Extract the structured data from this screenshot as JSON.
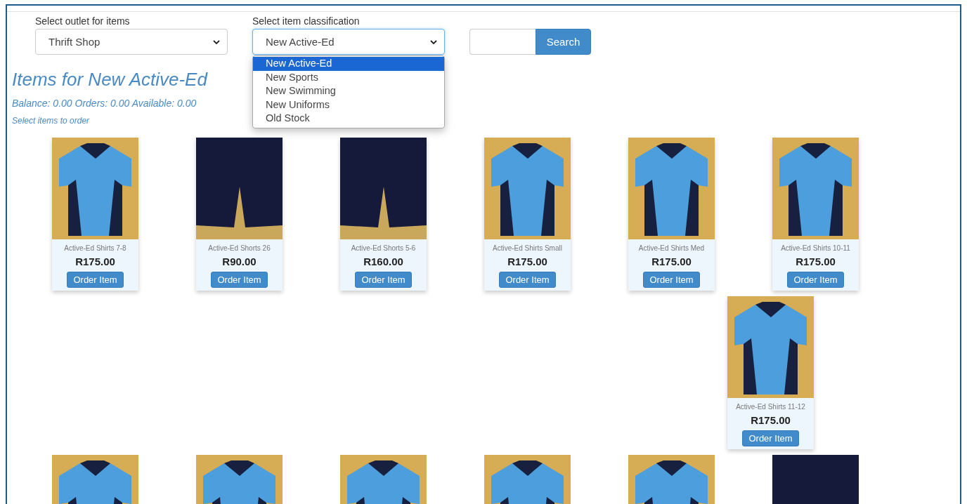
{
  "outlet_select": {
    "label": "Select outlet for items",
    "value": "Thrift Shop"
  },
  "classification_select": {
    "label": "Select item classification",
    "value": "New Active-Ed",
    "expanded": true,
    "options": [
      {
        "label": "New Active-Ed",
        "selected": true
      },
      {
        "label": "New Sports",
        "selected": false
      },
      {
        "label": "New Swimming",
        "selected": false
      },
      {
        "label": "New Uniforms",
        "selected": false
      },
      {
        "label": "Old Stock",
        "selected": false
      }
    ]
  },
  "search": {
    "button": "Search"
  },
  "heading": "Items for New Active-Ed",
  "balance_line": "Balance: 0.00 Orders: 0.00 Available: 0.00",
  "instruction": "Select items to order",
  "rows": [
    {
      "kind": "full",
      "items": [
        {
          "kind": "shirt",
          "name": "Active-Ed Shirts 7-8",
          "price": "R175.00",
          "button": "Order Item"
        },
        {
          "kind": "shorts",
          "name": "Active-Ed Shorts 26",
          "price": "R90.00",
          "button": "Order Item"
        },
        {
          "kind": "shorts",
          "name": "Active-Ed Shorts 5-6",
          "price": "R160.00",
          "button": "Order Item"
        },
        {
          "kind": "shirt",
          "name": "Active-Ed Shirts Small",
          "price": "R175.00",
          "button": "Order Item"
        },
        {
          "kind": "shirt",
          "name": "Active-Ed Shirts Med",
          "price": "R175.00",
          "button": "Order Item"
        },
        {
          "kind": "shirt",
          "name": "Active-Ed Shirts 10-11",
          "price": "R175.00",
          "button": "Order Item"
        }
      ]
    },
    {
      "kind": "last-column",
      "items": [
        {
          "kind": "shirt",
          "name": "Active-Ed Shirts 11-12",
          "price": "R175.00",
          "button": "Order Item"
        }
      ]
    },
    {
      "kind": "full",
      "items": [
        {
          "kind": "shirt"
        },
        {
          "kind": "shirt"
        },
        {
          "kind": "shirt"
        },
        {
          "kind": "shirt"
        },
        {
          "kind": "shirt"
        },
        {
          "kind": "shorts"
        }
      ]
    }
  ]
}
